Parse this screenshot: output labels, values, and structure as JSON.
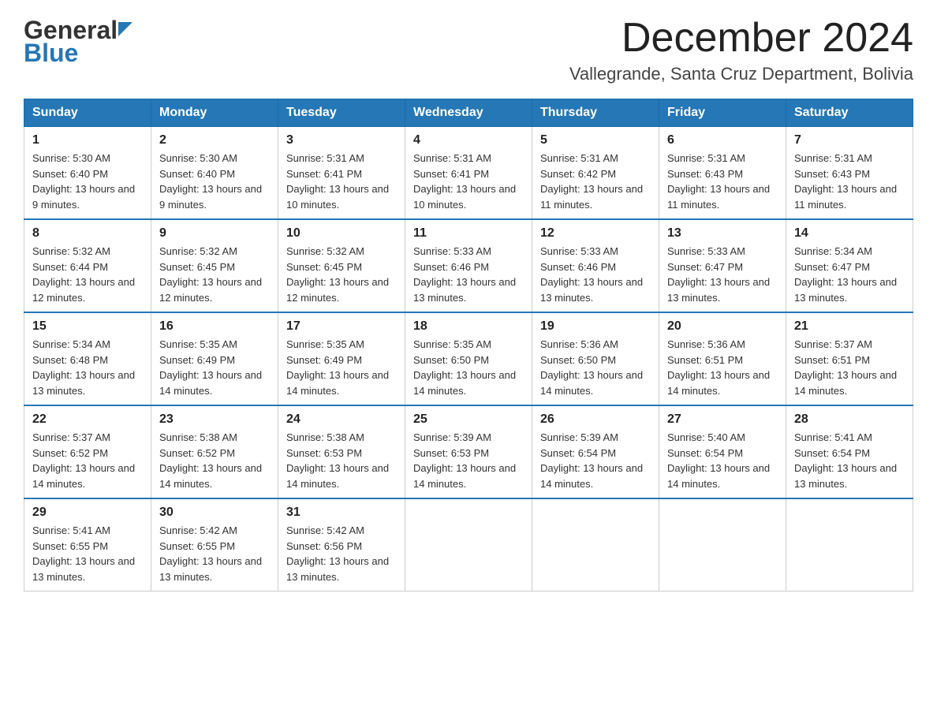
{
  "header": {
    "logo_general": "General",
    "logo_blue": "Blue",
    "month_title": "December 2024",
    "location": "Vallegrande, Santa Cruz Department, Bolivia"
  },
  "days_of_week": [
    "Sunday",
    "Monday",
    "Tuesday",
    "Wednesday",
    "Thursday",
    "Friday",
    "Saturday"
  ],
  "weeks": [
    [
      {
        "day": "1",
        "sunrise": "5:30 AM",
        "sunset": "6:40 PM",
        "daylight": "13 hours and 9 minutes."
      },
      {
        "day": "2",
        "sunrise": "5:30 AM",
        "sunset": "6:40 PM",
        "daylight": "13 hours and 9 minutes."
      },
      {
        "day": "3",
        "sunrise": "5:31 AM",
        "sunset": "6:41 PM",
        "daylight": "13 hours and 10 minutes."
      },
      {
        "day": "4",
        "sunrise": "5:31 AM",
        "sunset": "6:41 PM",
        "daylight": "13 hours and 10 minutes."
      },
      {
        "day": "5",
        "sunrise": "5:31 AM",
        "sunset": "6:42 PM",
        "daylight": "13 hours and 11 minutes."
      },
      {
        "day": "6",
        "sunrise": "5:31 AM",
        "sunset": "6:43 PM",
        "daylight": "13 hours and 11 minutes."
      },
      {
        "day": "7",
        "sunrise": "5:31 AM",
        "sunset": "6:43 PM",
        "daylight": "13 hours and 11 minutes."
      }
    ],
    [
      {
        "day": "8",
        "sunrise": "5:32 AM",
        "sunset": "6:44 PM",
        "daylight": "13 hours and 12 minutes."
      },
      {
        "day": "9",
        "sunrise": "5:32 AM",
        "sunset": "6:45 PM",
        "daylight": "13 hours and 12 minutes."
      },
      {
        "day": "10",
        "sunrise": "5:32 AM",
        "sunset": "6:45 PM",
        "daylight": "13 hours and 12 minutes."
      },
      {
        "day": "11",
        "sunrise": "5:33 AM",
        "sunset": "6:46 PM",
        "daylight": "13 hours and 13 minutes."
      },
      {
        "day": "12",
        "sunrise": "5:33 AM",
        "sunset": "6:46 PM",
        "daylight": "13 hours and 13 minutes."
      },
      {
        "day": "13",
        "sunrise": "5:33 AM",
        "sunset": "6:47 PM",
        "daylight": "13 hours and 13 minutes."
      },
      {
        "day": "14",
        "sunrise": "5:34 AM",
        "sunset": "6:47 PM",
        "daylight": "13 hours and 13 minutes."
      }
    ],
    [
      {
        "day": "15",
        "sunrise": "5:34 AM",
        "sunset": "6:48 PM",
        "daylight": "13 hours and 13 minutes."
      },
      {
        "day": "16",
        "sunrise": "5:35 AM",
        "sunset": "6:49 PM",
        "daylight": "13 hours and 14 minutes."
      },
      {
        "day": "17",
        "sunrise": "5:35 AM",
        "sunset": "6:49 PM",
        "daylight": "13 hours and 14 minutes."
      },
      {
        "day": "18",
        "sunrise": "5:35 AM",
        "sunset": "6:50 PM",
        "daylight": "13 hours and 14 minutes."
      },
      {
        "day": "19",
        "sunrise": "5:36 AM",
        "sunset": "6:50 PM",
        "daylight": "13 hours and 14 minutes."
      },
      {
        "day": "20",
        "sunrise": "5:36 AM",
        "sunset": "6:51 PM",
        "daylight": "13 hours and 14 minutes."
      },
      {
        "day": "21",
        "sunrise": "5:37 AM",
        "sunset": "6:51 PM",
        "daylight": "13 hours and 14 minutes."
      }
    ],
    [
      {
        "day": "22",
        "sunrise": "5:37 AM",
        "sunset": "6:52 PM",
        "daylight": "13 hours and 14 minutes."
      },
      {
        "day": "23",
        "sunrise": "5:38 AM",
        "sunset": "6:52 PM",
        "daylight": "13 hours and 14 minutes."
      },
      {
        "day": "24",
        "sunrise": "5:38 AM",
        "sunset": "6:53 PM",
        "daylight": "13 hours and 14 minutes."
      },
      {
        "day": "25",
        "sunrise": "5:39 AM",
        "sunset": "6:53 PM",
        "daylight": "13 hours and 14 minutes."
      },
      {
        "day": "26",
        "sunrise": "5:39 AM",
        "sunset": "6:54 PM",
        "daylight": "13 hours and 14 minutes."
      },
      {
        "day": "27",
        "sunrise": "5:40 AM",
        "sunset": "6:54 PM",
        "daylight": "13 hours and 14 minutes."
      },
      {
        "day": "28",
        "sunrise": "5:41 AM",
        "sunset": "6:54 PM",
        "daylight": "13 hours and 13 minutes."
      }
    ],
    [
      {
        "day": "29",
        "sunrise": "5:41 AM",
        "sunset": "6:55 PM",
        "daylight": "13 hours and 13 minutes."
      },
      {
        "day": "30",
        "sunrise": "5:42 AM",
        "sunset": "6:55 PM",
        "daylight": "13 hours and 13 minutes."
      },
      {
        "day": "31",
        "sunrise": "5:42 AM",
        "sunset": "6:56 PM",
        "daylight": "13 hours and 13 minutes."
      },
      null,
      null,
      null,
      null
    ]
  ],
  "labels": {
    "sunrise_prefix": "Sunrise: ",
    "sunset_prefix": "Sunset: ",
    "daylight_prefix": "Daylight: "
  },
  "colors": {
    "header_bg": "#2577b5",
    "header_text": "#ffffff",
    "border_color": "#aaa",
    "row_divider": "#2577b5"
  }
}
